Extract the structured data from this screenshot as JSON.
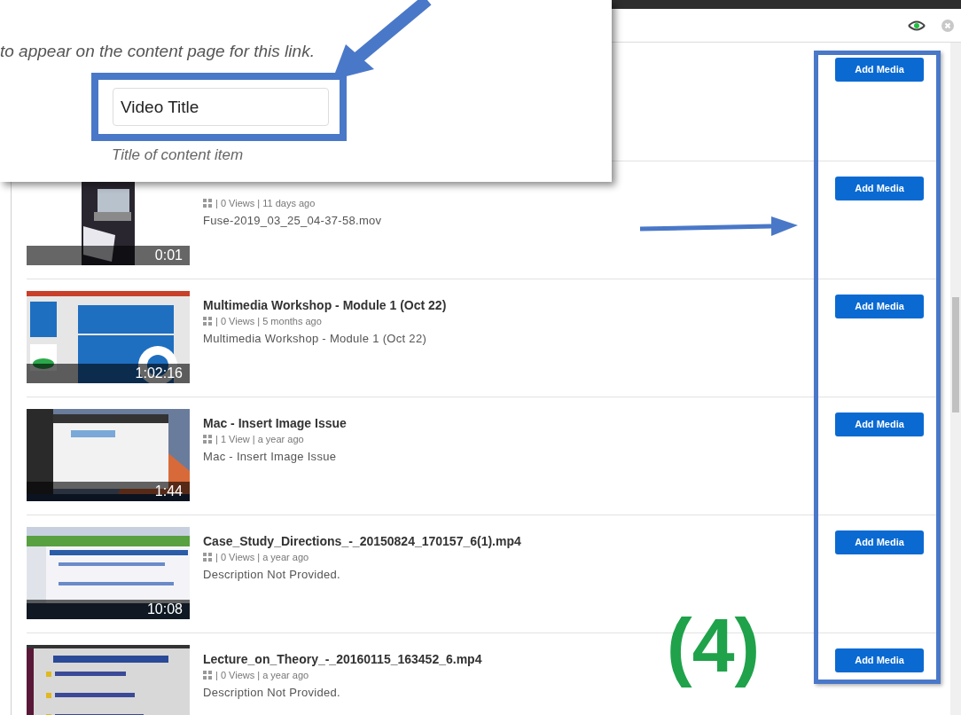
{
  "popup": {
    "hint": "to appear on the content page for this link.",
    "title_field": {
      "value": "Video Title"
    },
    "caption": "Title of content item"
  },
  "media_list": [
    {
      "button": "Add Media"
    },
    {
      "duration": "0:01",
      "meta": "| 0 Views | 11 days ago",
      "description": "Fuse-2019_03_25_04-37-58.mov",
      "button": "Add Media"
    },
    {
      "duration": "1:02:16",
      "title": "Multimedia Workshop - Module 1 (Oct 22)",
      "meta": "| 0 Views | 5 months ago",
      "description": "Multimedia Workshop - Module 1 (Oct 22)",
      "button": "Add Media"
    },
    {
      "duration": "1:44",
      "title": "Mac - Insert Image Issue",
      "meta": "| 1 View | a year ago",
      "description": "Mac - Insert Image Issue",
      "button": "Add Media"
    },
    {
      "duration": "10:08",
      "title": "Case_Study_Directions_-_20150824_170157_6(1).mp4",
      "meta": "| 0 Views | a year ago",
      "description": "Description Not Provided.",
      "button": "Add Media"
    },
    {
      "title": "Lecture_on_Theory_-_20160115_163452_6.mp4",
      "meta": "| 0 Views | a year ago",
      "description": "Description Not Provided.",
      "button": "Add Media"
    }
  ],
  "step_label": "(4)"
}
